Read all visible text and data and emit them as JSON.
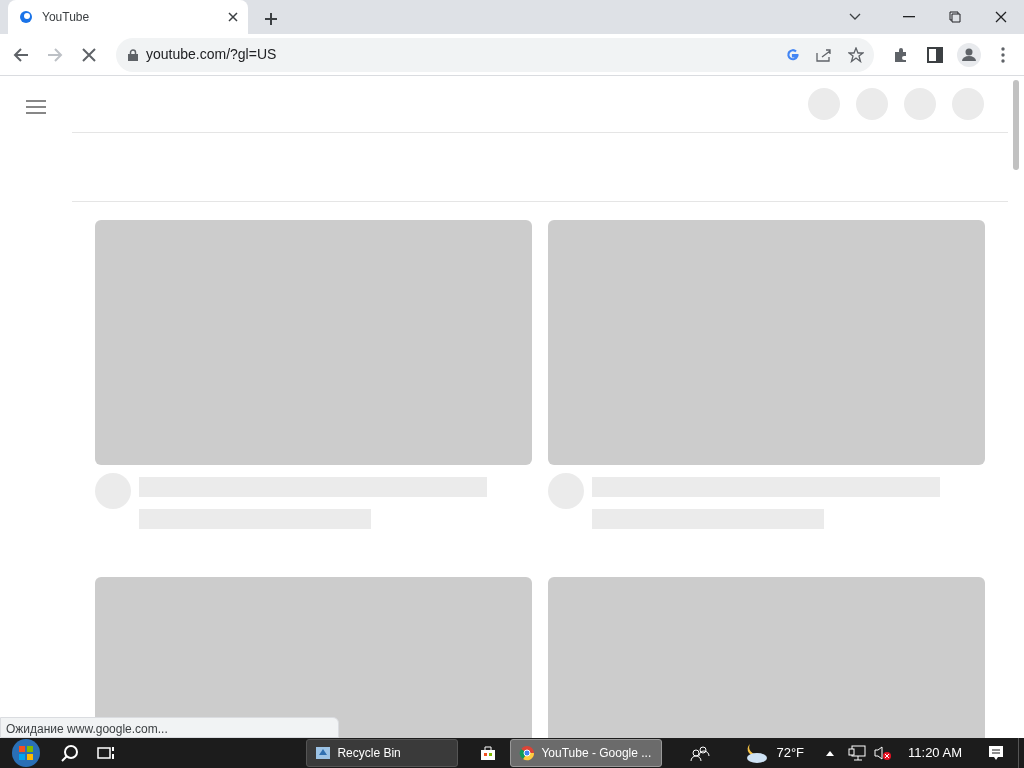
{
  "browser": {
    "tabs": [
      {
        "title": "YouTube",
        "selected": true
      }
    ],
    "address": "youtube.com/?gl=US",
    "loading": true
  },
  "page": {
    "header_skeletons": [
      {
        "kind": "circle"
      },
      {
        "kind": "circle"
      },
      {
        "kind": "circle"
      },
      {
        "kind": "circle"
      }
    ],
    "video_skeletons": [
      {
        "kind": "video"
      },
      {
        "kind": "video"
      },
      {
        "kind": "thumbnail"
      },
      {
        "kind": "thumbnail"
      }
    ]
  },
  "status_text": "Ожидание www.google.com...",
  "taskbar": {
    "buttons": [
      {
        "label": "Recycle Bin",
        "kind": "folder",
        "selected": false
      },
      {
        "label": "YouTube - Google ...",
        "kind": "browser",
        "selected": true
      }
    ],
    "temperature": "72°F",
    "volume_muted": true,
    "time": "11:20 AM"
  }
}
